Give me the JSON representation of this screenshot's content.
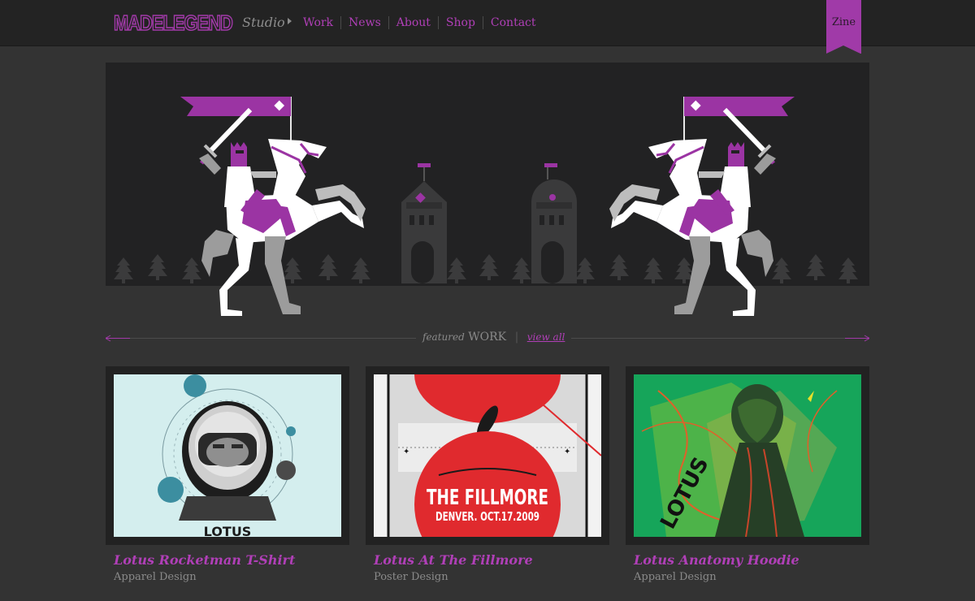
{
  "header": {
    "logo_text": "MADELEGEND",
    "section": "Studio",
    "nav": [
      "Work",
      "News",
      "About",
      "Shop",
      "Contact"
    ],
    "zine": "Zine"
  },
  "featured": {
    "lead": "featured",
    "heading": "WORK",
    "view_all": "view all"
  },
  "cards": [
    {
      "title": "Lotus Rocketman T-Shirt",
      "category": "Apparel Design",
      "art": "astronaut-helmet",
      "art_text": "LOTUS"
    },
    {
      "title": "Lotus At The Fillmore",
      "category": "Poster Design",
      "art": "fillmore-poster",
      "art_text_1": "THE FILLMORE",
      "art_text_2": "DENVER. OCT.17.2009"
    },
    {
      "title": "Lotus Anatomy Hoodie",
      "category": "Apparel Design",
      "art": "anatomy-figure",
      "art_text": "LOTUS"
    }
  ],
  "colors": {
    "accent": "#b03fb7",
    "page_bg": "#333333",
    "header_bg": "#232323",
    "hero_bg": "#222223"
  }
}
